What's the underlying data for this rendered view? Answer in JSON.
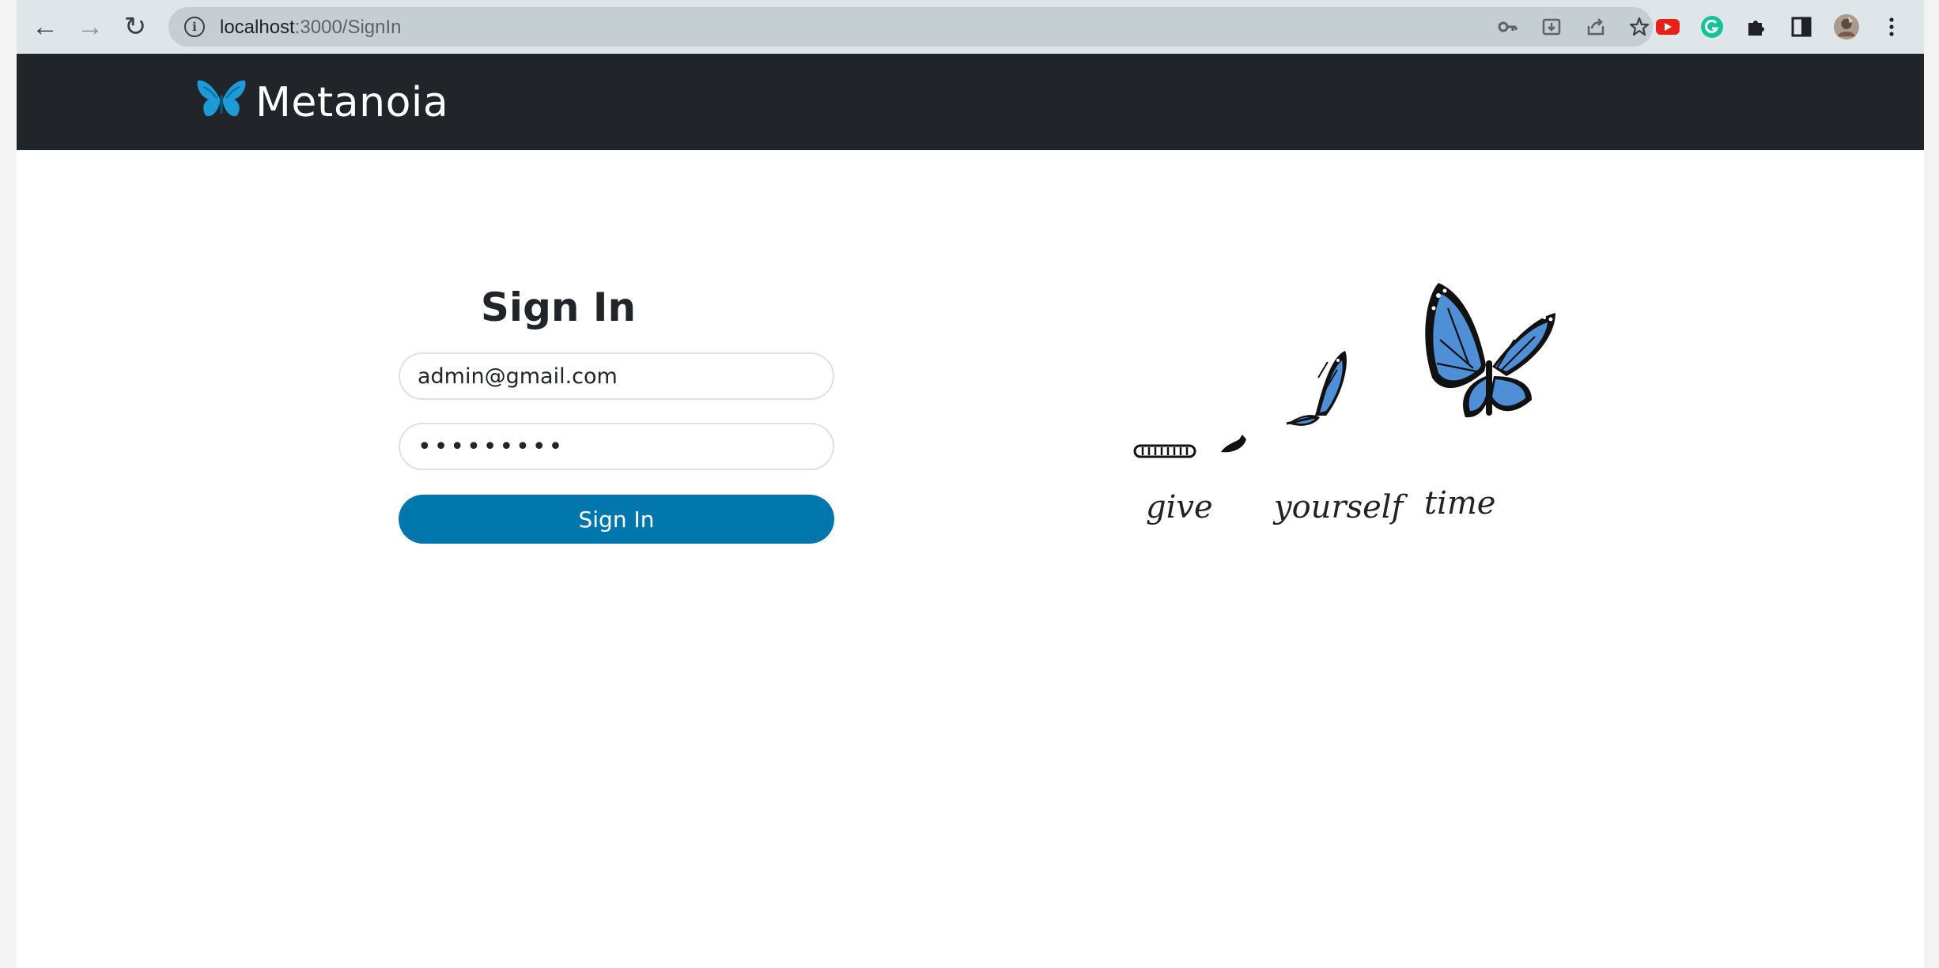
{
  "browser": {
    "url_host": "localhost",
    "url_path": ":3000/SignIn",
    "nav": {
      "back": "←",
      "forward": "→",
      "reload": "↻"
    },
    "icons": [
      "key-icon",
      "install-icon",
      "share-icon",
      "star-icon",
      "youtube-extension-icon",
      "grammarly-extension-icon",
      "extensions-puzzle-icon",
      "sidepanel-icon",
      "profile-avatar",
      "menu-kebab-icon"
    ]
  },
  "navbar": {
    "brand": "Metanoia"
  },
  "signin": {
    "heading": "Sign In",
    "email_value": "admin@gmail.com",
    "password_value": "•••••••••",
    "button_label": "Sign In"
  },
  "illustration": {
    "words": [
      "give",
      "yourself",
      "time"
    ]
  },
  "colors": {
    "navbar_bg": "#212529",
    "button_bg": "#0077ac",
    "butterfly_blue": "#4f8fd6"
  }
}
